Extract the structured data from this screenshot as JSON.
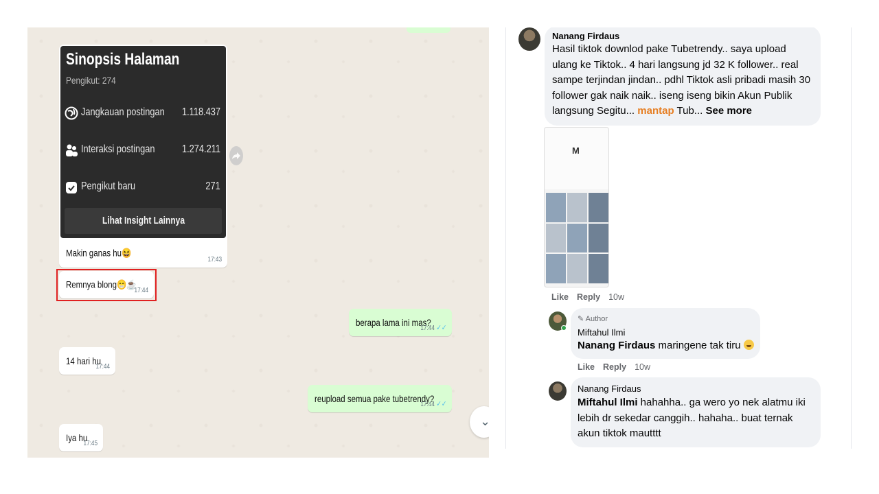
{
  "whatsapp": {
    "shared_card": {
      "title": "Sinopsis Halaman",
      "followers": "Pengikut: 274",
      "stats": [
        {
          "icon": "globe-icon",
          "label": "Jangkauan postingan",
          "value": "1.118.437"
        },
        {
          "icon": "people-icon",
          "label": "Interaksi postingan",
          "value": "1.274.211"
        },
        {
          "icon": "follower-badge-icon",
          "label": "Pengikut baru",
          "value": "271"
        }
      ],
      "button_label": "Lihat Insight Lainnya"
    },
    "messages": [
      {
        "dir": "in",
        "text": "Makin ganas hu😆",
        "time": "17:43"
      },
      {
        "dir": "in",
        "text": "Remnya blong😁☕",
        "time": "17:44"
      },
      {
        "dir": "out",
        "text": "berapa lama ini mas?",
        "time": "17:44"
      },
      {
        "dir": "in",
        "text": "14 hari hu",
        "time": "17:44"
      },
      {
        "dir": "out",
        "text": "reupload semua pake tubetrendy?",
        "time": "17:44"
      },
      {
        "dir": "in",
        "text": "Iya hu",
        "time": "17:45"
      }
    ],
    "read_tick": "✓✓",
    "scroll_icon": "chevron-down-icon"
  },
  "facebook": {
    "comment": {
      "name": "Nanang Firdaus",
      "text_lines": [
        "Hasil tiktok downlod pake Tubetrendy.. saya upload",
        "ulang ke Tiktok.. 4 hari langsung jd 32 K follower.. real",
        "sampe terjindan jindan.. pdhl Tiktok asli pribadi masih 30",
        "follower gak naik naik.. iseng iseng bikin Akun Publik"
      ],
      "last_line_prefix": "langsung Segitu... ",
      "highlight_word": "mantap",
      "last_line_suffix": " Tub... ",
      "see_more": "See more",
      "like": "Like",
      "reply": "Reply",
      "age": "10w",
      "screenshot_logo": "M"
    },
    "reply1": {
      "badge": "Author",
      "name": "Miftahul Ilmi",
      "mention": "Nanang Firdaus",
      "text": " maringene tak tiru ",
      "like": "Like",
      "reply": "Reply",
      "age": "10w"
    },
    "reply2": {
      "name": "Nanang Firdaus",
      "mention": "Miftahul Ilmi",
      "line1": " hahahha.. ga wero yo nek alatmu iki",
      "line2": "lebih dr sekedar canggih.. hahaha.. buat ternak",
      "line3": "akun tiktok mautttt"
    }
  }
}
